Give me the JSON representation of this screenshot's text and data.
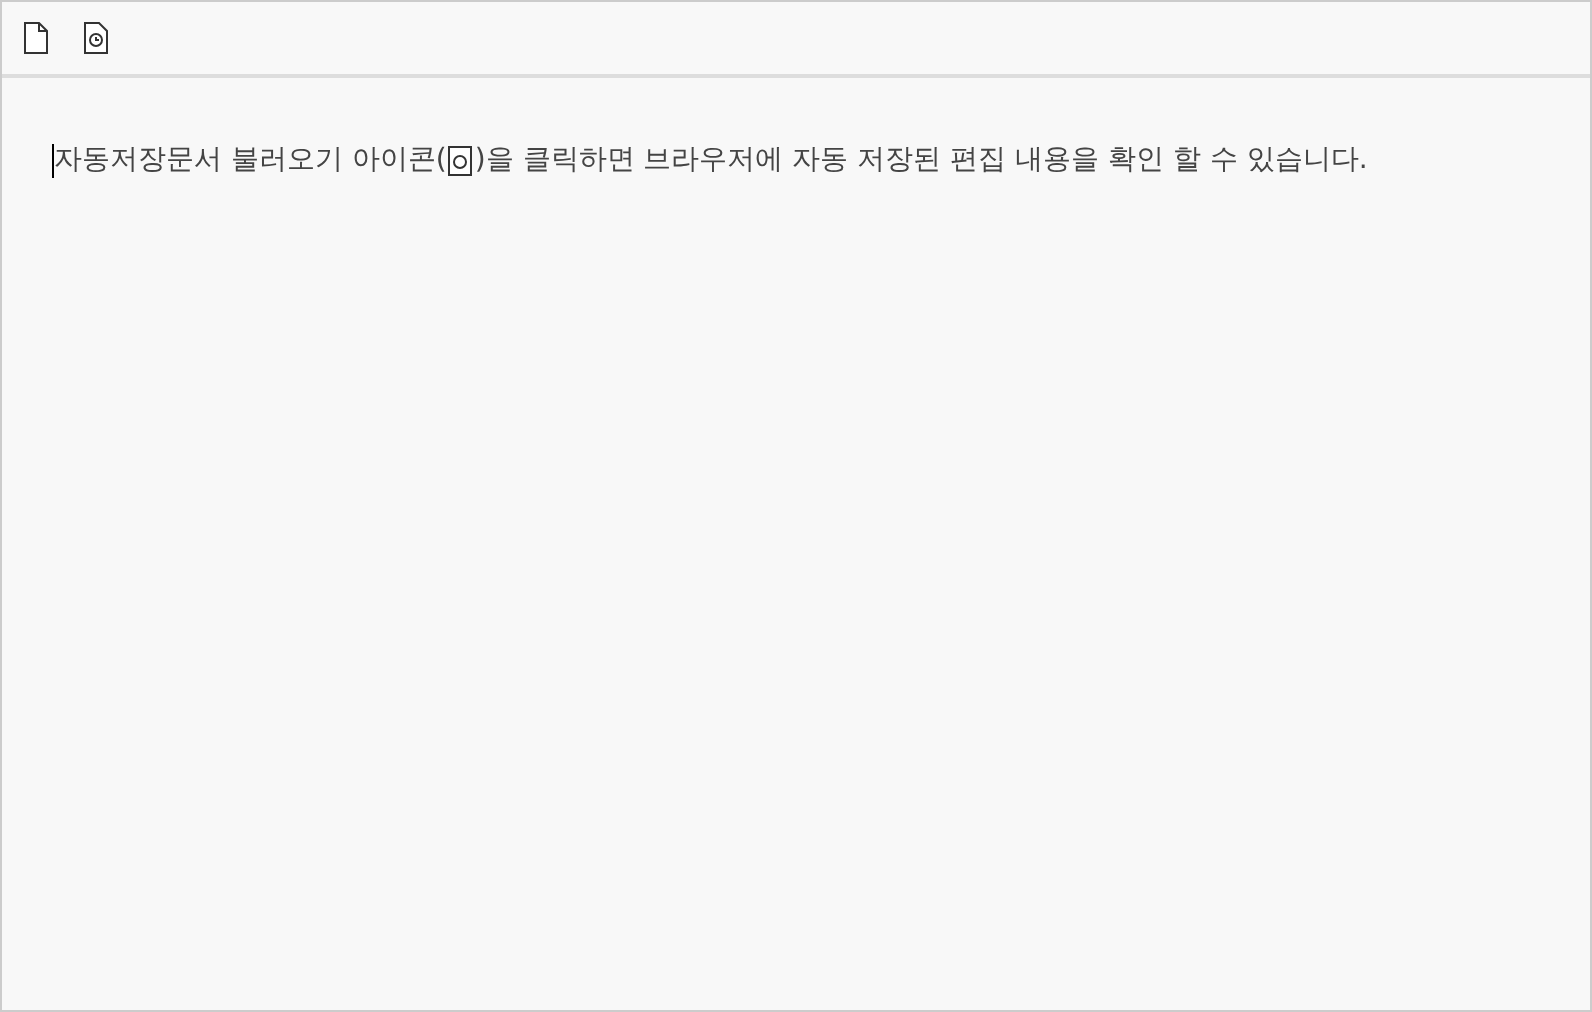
{
  "toolbar": {
    "buttons": [
      {
        "kind": "new-document"
      },
      {
        "kind": "load-autosave"
      }
    ]
  },
  "editor": {
    "text_before": "자동저장문서 불러오기 아이콘(",
    "inline_icon": {
      "kind": "load-autosave"
    },
    "text_after": ")을 클릭하면 브라우저에 자동 저장된 편집 내용을 확인 할 수 있습니다.",
    "cursor": true
  }
}
